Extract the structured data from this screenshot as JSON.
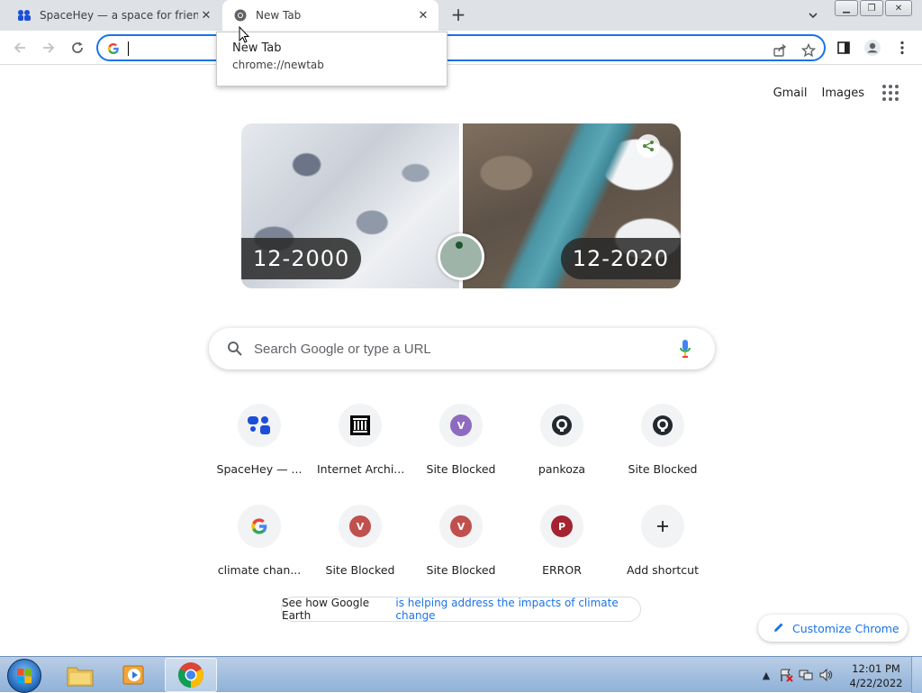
{
  "tabs": [
    {
      "title": "SpaceHey — a space for friends.",
      "icon": "spacehey-icon",
      "active": false
    },
    {
      "title": "New Tab",
      "icon": "chrome-icon",
      "active": true
    }
  ],
  "hovercard": {
    "title": "New Tab",
    "url": "chrome://newtab"
  },
  "omnibox": {
    "value": ""
  },
  "top_links": {
    "gmail": "Gmail",
    "images": "Images"
  },
  "doodle": {
    "left_date": "12-2000",
    "right_date": "12-2020"
  },
  "search": {
    "placeholder": "Search Google or type a URL"
  },
  "shortcuts": [
    {
      "label": "SpaceHey — ...",
      "icon": "spacehey-icon"
    },
    {
      "label": "Internet Archi...",
      "icon": "internet-archive-icon"
    },
    {
      "label": "Site Blocked",
      "icon": "letter-v-icon",
      "letter": "V",
      "color": "#8e6bbf"
    },
    {
      "label": "pankoza",
      "icon": "github-icon"
    },
    {
      "label": "Site Blocked",
      "icon": "github-icon"
    },
    {
      "label": "climate chan...",
      "icon": "google-g-icon"
    },
    {
      "label": "Site Blocked",
      "icon": "letter-v-icon",
      "letter": "V",
      "color": "#c0504d"
    },
    {
      "label": "Site Blocked",
      "icon": "letter-v-icon",
      "letter": "V",
      "color": "#c0504d"
    },
    {
      "label": "ERROR",
      "icon": "letter-p-icon",
      "letter": "P",
      "color": "#a52230"
    },
    {
      "label": "Add shortcut",
      "icon": "plus-icon"
    }
  ],
  "earth_chip": {
    "plain": "See how Google Earth",
    "link": "is helping address the impacts of climate change"
  },
  "customize": {
    "label": "Customize Chrome"
  },
  "taskbar": {
    "time": "12:01 PM",
    "date": "4/22/2022"
  },
  "colors": {
    "accent": "#1a73e8",
    "tabstrip": "#dee1e6"
  }
}
